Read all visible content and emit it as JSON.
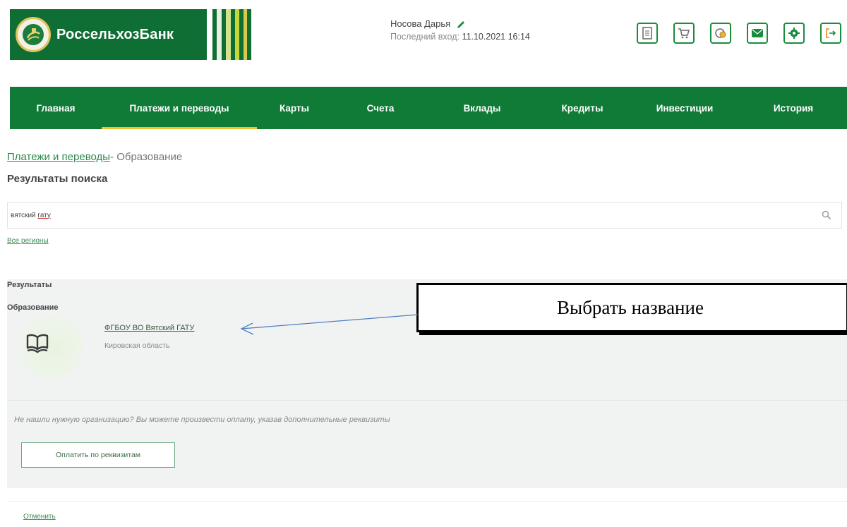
{
  "header": {
    "logo_text": "РоссельхозБанк",
    "user_name": "Носова Дарья",
    "last_login_label": "Последний вход:",
    "last_login_value": "11.10.2021 16:14",
    "icons": [
      "document-icon",
      "cart-icon",
      "coins-icon",
      "mail-icon",
      "settings-icon",
      "logout-icon"
    ]
  },
  "nav": {
    "items": [
      {
        "label": "Главная"
      },
      {
        "label": "Платежи и переводы",
        "active": true
      },
      {
        "label": "Карты"
      },
      {
        "label": "Счета"
      },
      {
        "label": "Вклады"
      },
      {
        "label": "Кредиты"
      },
      {
        "label": "Инвестиции"
      },
      {
        "label": "История"
      }
    ]
  },
  "breadcrumb": {
    "link": "Платежи и переводы",
    "current": "- Образование"
  },
  "page_title": "Результаты поиска",
  "search": {
    "value_prefix": "вятский ",
    "value_underlined": "гату"
  },
  "regions_link": "Все регионы",
  "results": {
    "title": "Результаты",
    "category": "Образование",
    "items": [
      {
        "name": "ФГБОУ ВО Вятский ГАТУ",
        "region": "Кировская область"
      }
    ],
    "not_found_note": "Не нашли нужную организацию? Вы можете произвести оплату, указав дополнительные реквизиты",
    "pay_button": "Оплатить по реквизитам"
  },
  "cancel_link": "Отменить",
  "callout": {
    "text": "Выбрать название"
  },
  "colors": {
    "brand_green": "#107a37",
    "accent_yellow": "#f1c232",
    "results_bg": "#f1f3f3"
  }
}
